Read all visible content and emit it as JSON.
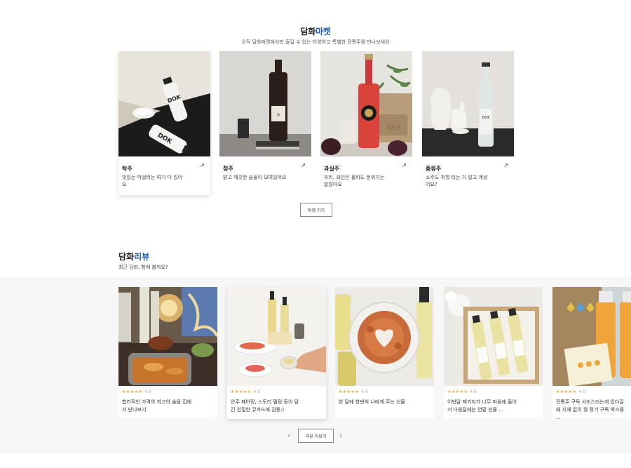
{
  "market": {
    "title_prefix": "담화",
    "title_accent": "마켓",
    "subtitle": "오직 담화마켓에서만 즐길 수 있는 다양하고 특별한 전통주를 만나보세요",
    "button_label": "마켓 가기",
    "categories": [
      {
        "name": "탁주",
        "desc": "맛있는 막걸리는 여기 다 있어요",
        "arrow": "↗"
      },
      {
        "name": "청주",
        "desc": "맑고 깨끗한 술들이 모여있어요",
        "arrow": "↗"
      },
      {
        "name": "과실주",
        "desc": "우리, 와인은 몰라도 분위기는 알잖아요",
        "arrow": "↗"
      },
      {
        "name": "증류주",
        "desc": "소주도 취향 타는 거 알고 계셨어요?",
        "arrow": "↗"
      }
    ]
  },
  "review": {
    "title_prefix": "담화",
    "title_accent": "리뷰",
    "subtitle": "최근 담화, 함께 볼까요?",
    "more_label": "리뷰 더보기",
    "prev_icon": "‹",
    "next_icon": "›",
    "items": [
      {
        "stars": "★★★★★",
        "score": "4.6",
        "text": "합리적인 가격의 최고의 술을 집에서 만나보기"
      },
      {
        "stars": "★★★★★",
        "score": "4.6",
        "text": "안주 페어링, 스토리 텔링 등이 담긴 친절한 큐카드에 감동:)"
      },
      {
        "stars": "★★★★★",
        "score": "4.6",
        "text": "한 달에 한번씩 나에게 주는 선물"
      },
      {
        "stars": "★★★★★",
        "score": "4.6",
        "text": "이번달 패키지가 너무 마음에 들어서 다음달에는 연말 선물 ..."
      },
      {
        "stars": "★★★★★",
        "score": "4.6",
        "text": "전통주 구독 서비스라는게 있다길래 지체 없이 월 정기 구독 박스를 ..."
      }
    ]
  },
  "colors": {
    "accent": "#1f5bbf",
    "star": "#f5a623"
  }
}
